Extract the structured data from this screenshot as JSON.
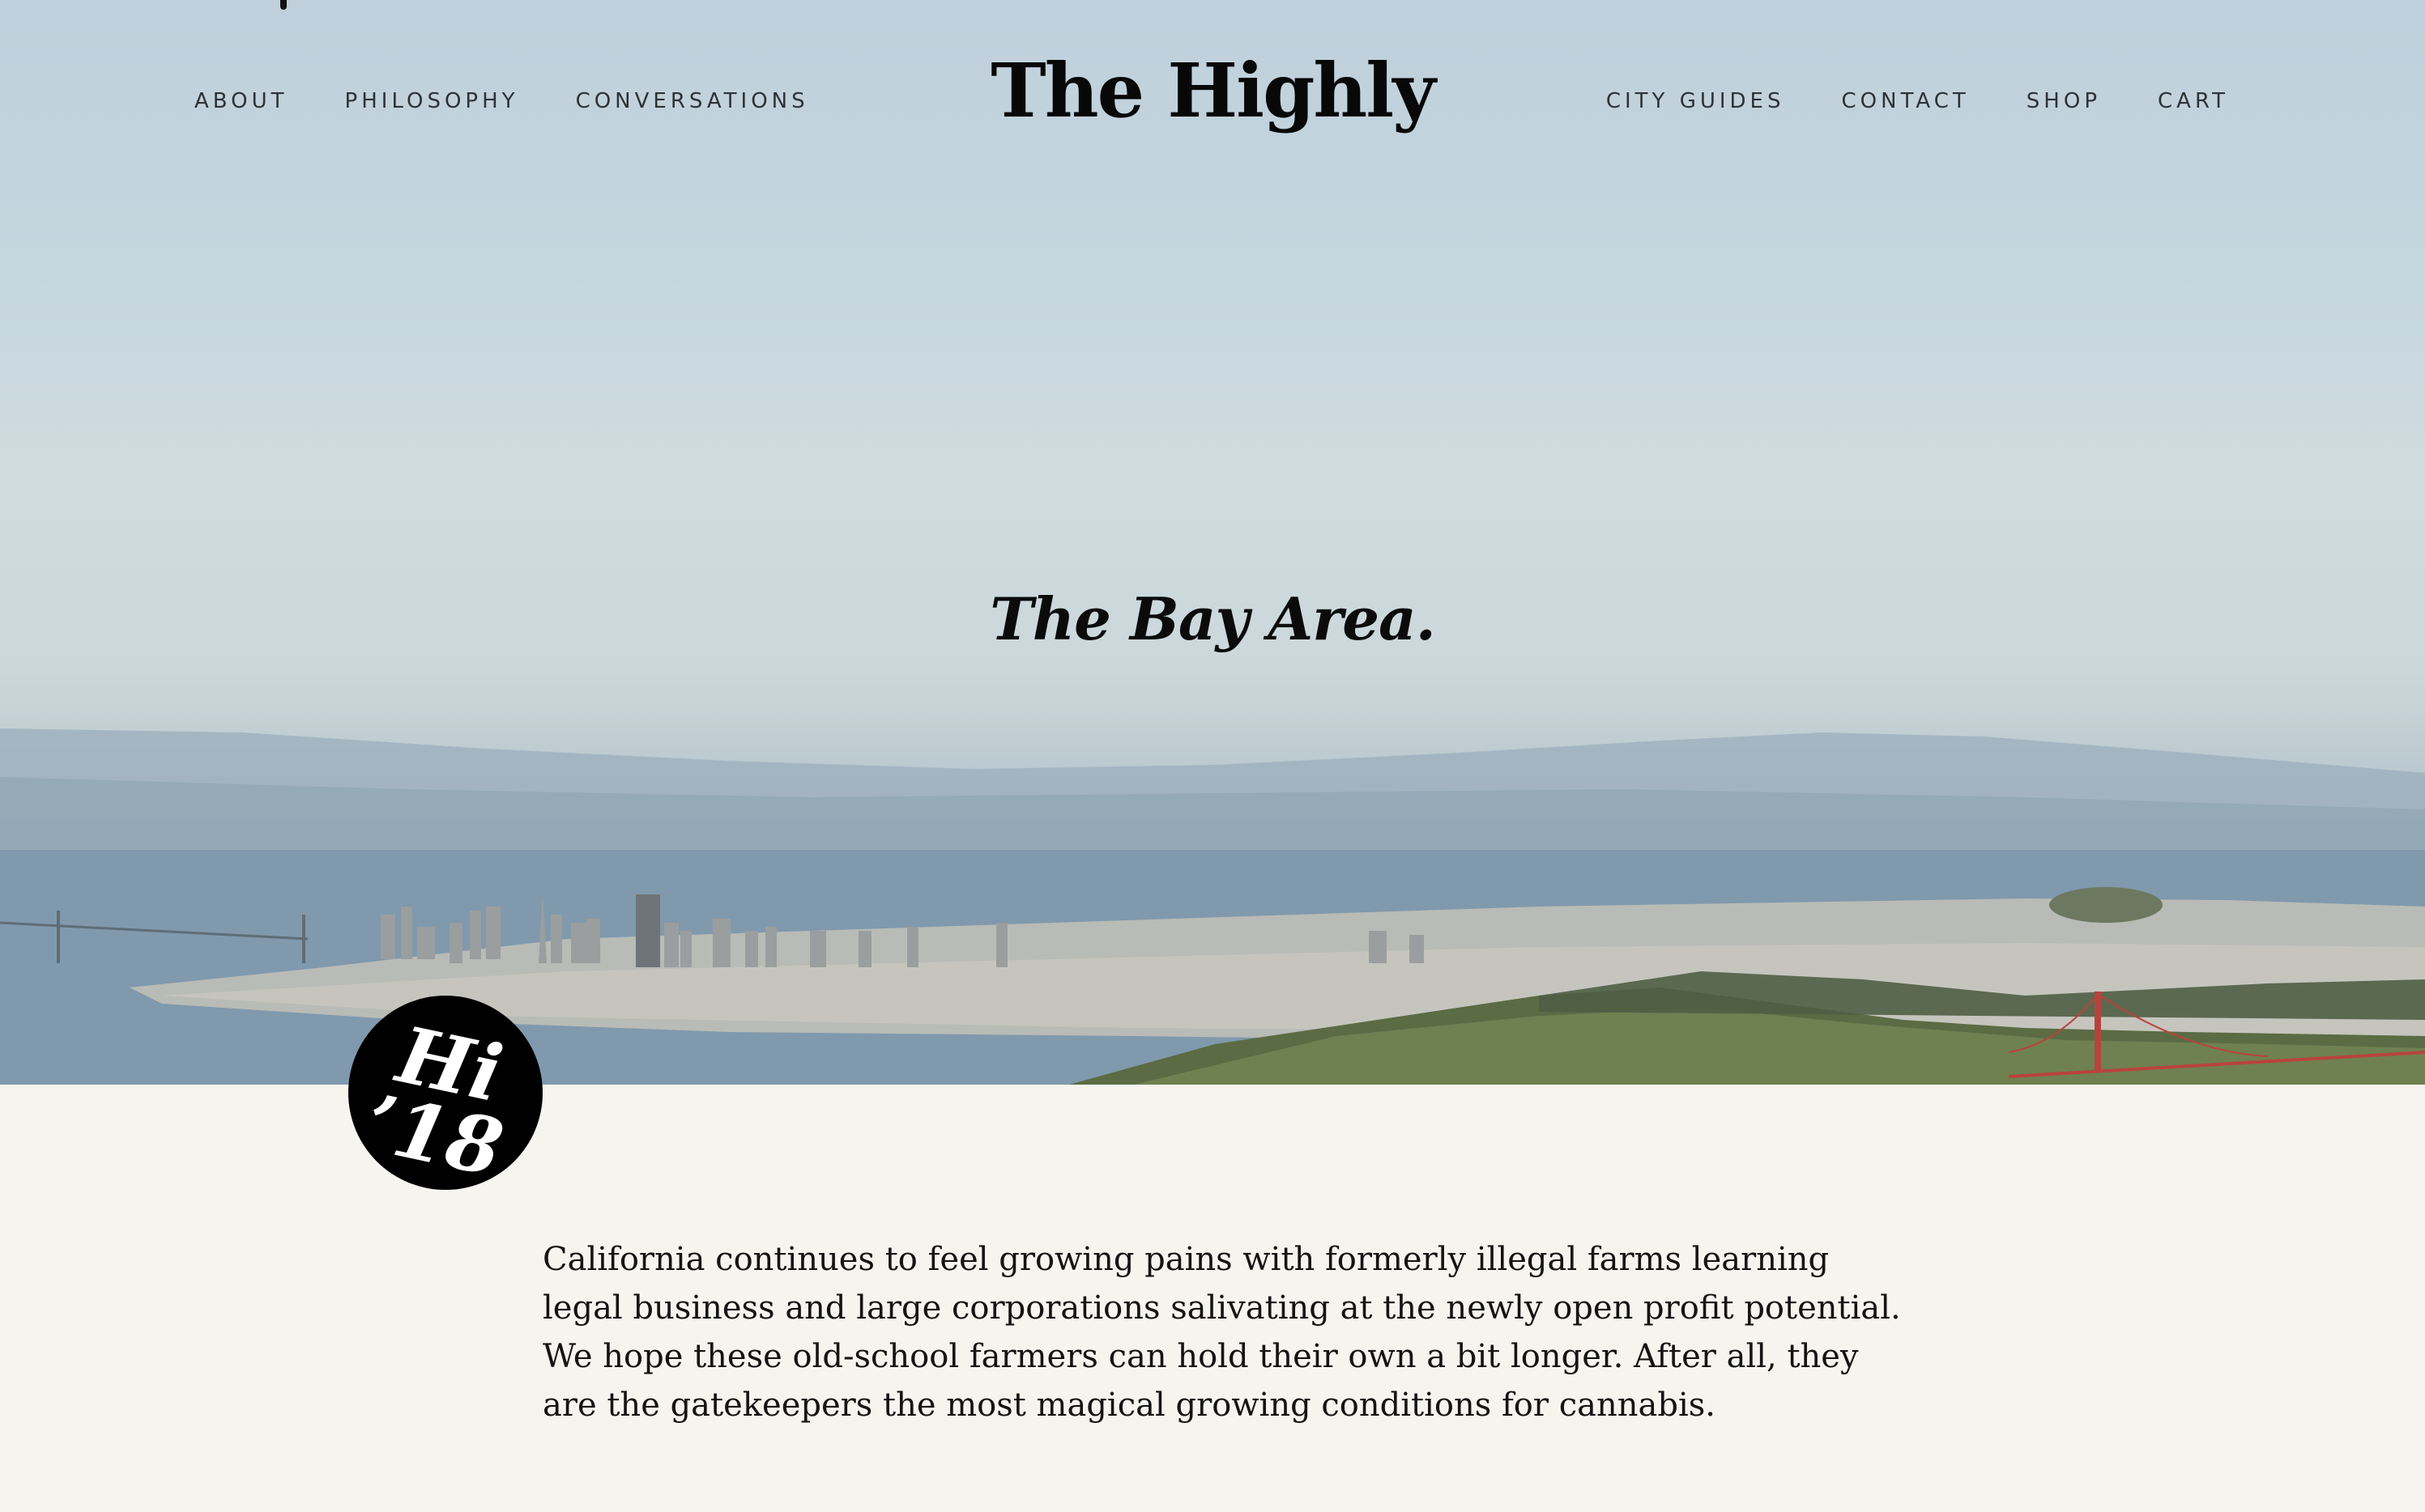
{
  "nav": {
    "left": [
      {
        "label": "ABOUT"
      },
      {
        "label": "PHILOSOPHY"
      },
      {
        "label": "CONVERSATIONS"
      }
    ],
    "right": [
      {
        "label": "CITY GUIDES"
      },
      {
        "label": "CONTACT"
      },
      {
        "label": "SHOP"
      },
      {
        "label": "CART"
      }
    ]
  },
  "logo": {
    "text": "The Highly"
  },
  "hero": {
    "title": "The Bay Area."
  },
  "badge": {
    "line1": "Hi",
    "line2": "’18"
  },
  "intro": {
    "text": "California continues to feel growing pains with formerly illegal farms learning legal business and large corporations salivating at the newly open profit potential. We hope these old-school farmers can hold their own a bit longer. After all, they are the gatekeepers the most magical growing conditions for cannabis."
  },
  "colors": {
    "page_background": "#f6f4ee",
    "text": "#111111",
    "badge": "#000000"
  }
}
